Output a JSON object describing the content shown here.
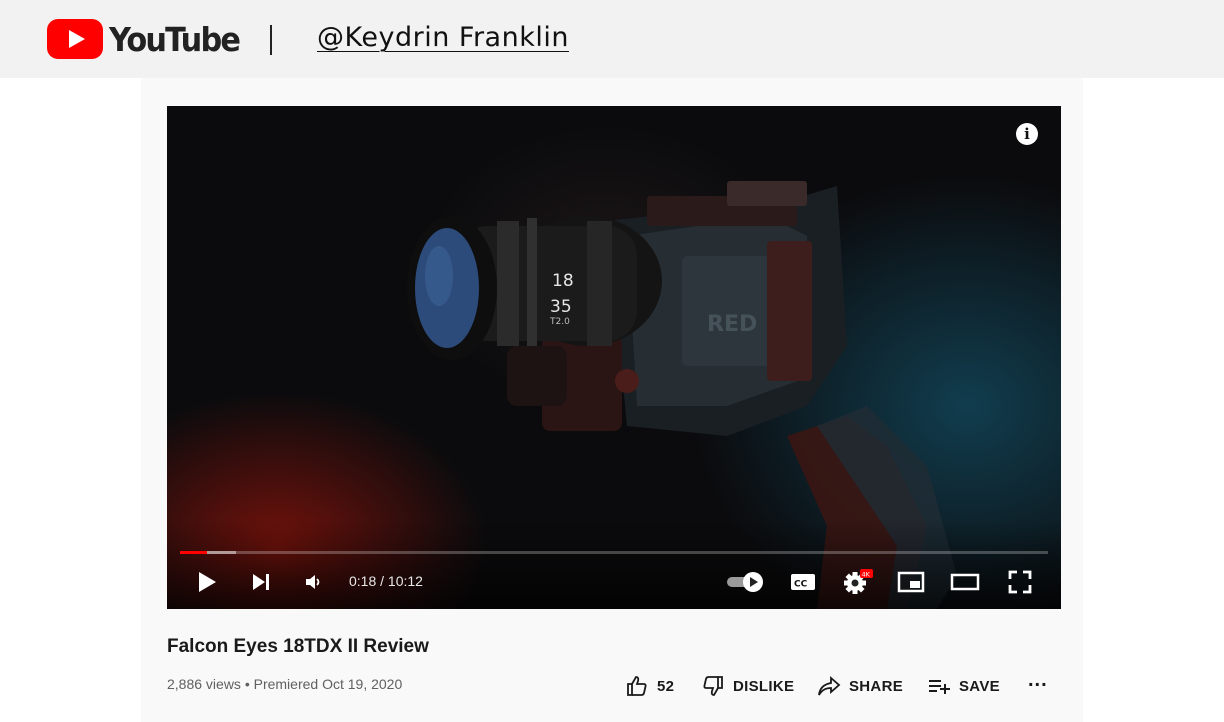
{
  "header": {
    "logo_text": "YouTube",
    "channel_handle": "@Keydrin Franklin"
  },
  "player": {
    "time_current": "0:18",
    "time_total": "10:12",
    "time_display": "0:18 / 10:12",
    "progress_fraction": 0.031,
    "buffer_fraction": 0.065,
    "settings_badge": "4K",
    "lens_marks": {
      "top": "18",
      "bottom": "35",
      "aperture": "T2.0"
    },
    "camera_brand": "RED",
    "icons": [
      "info-icon",
      "play-icon",
      "next-icon",
      "volume-icon",
      "autoplay-toggle",
      "captions-icon",
      "settings-icon",
      "miniplayer-icon",
      "theater-icon",
      "fullscreen-icon"
    ]
  },
  "video": {
    "title": "Falcon Eyes 18TDX II Review",
    "meta": "2,886 views • Premiered Oct 19, 2020"
  },
  "actions": {
    "like_count": "52",
    "dislike_label": "DISLIKE",
    "share_label": "SHARE",
    "save_label": "SAVE",
    "more_label": "..."
  },
  "colors": {
    "brand_red": "#ff0000",
    "topbar_bg": "#f2f2f2",
    "card_bg": "#f9f9f9"
  }
}
